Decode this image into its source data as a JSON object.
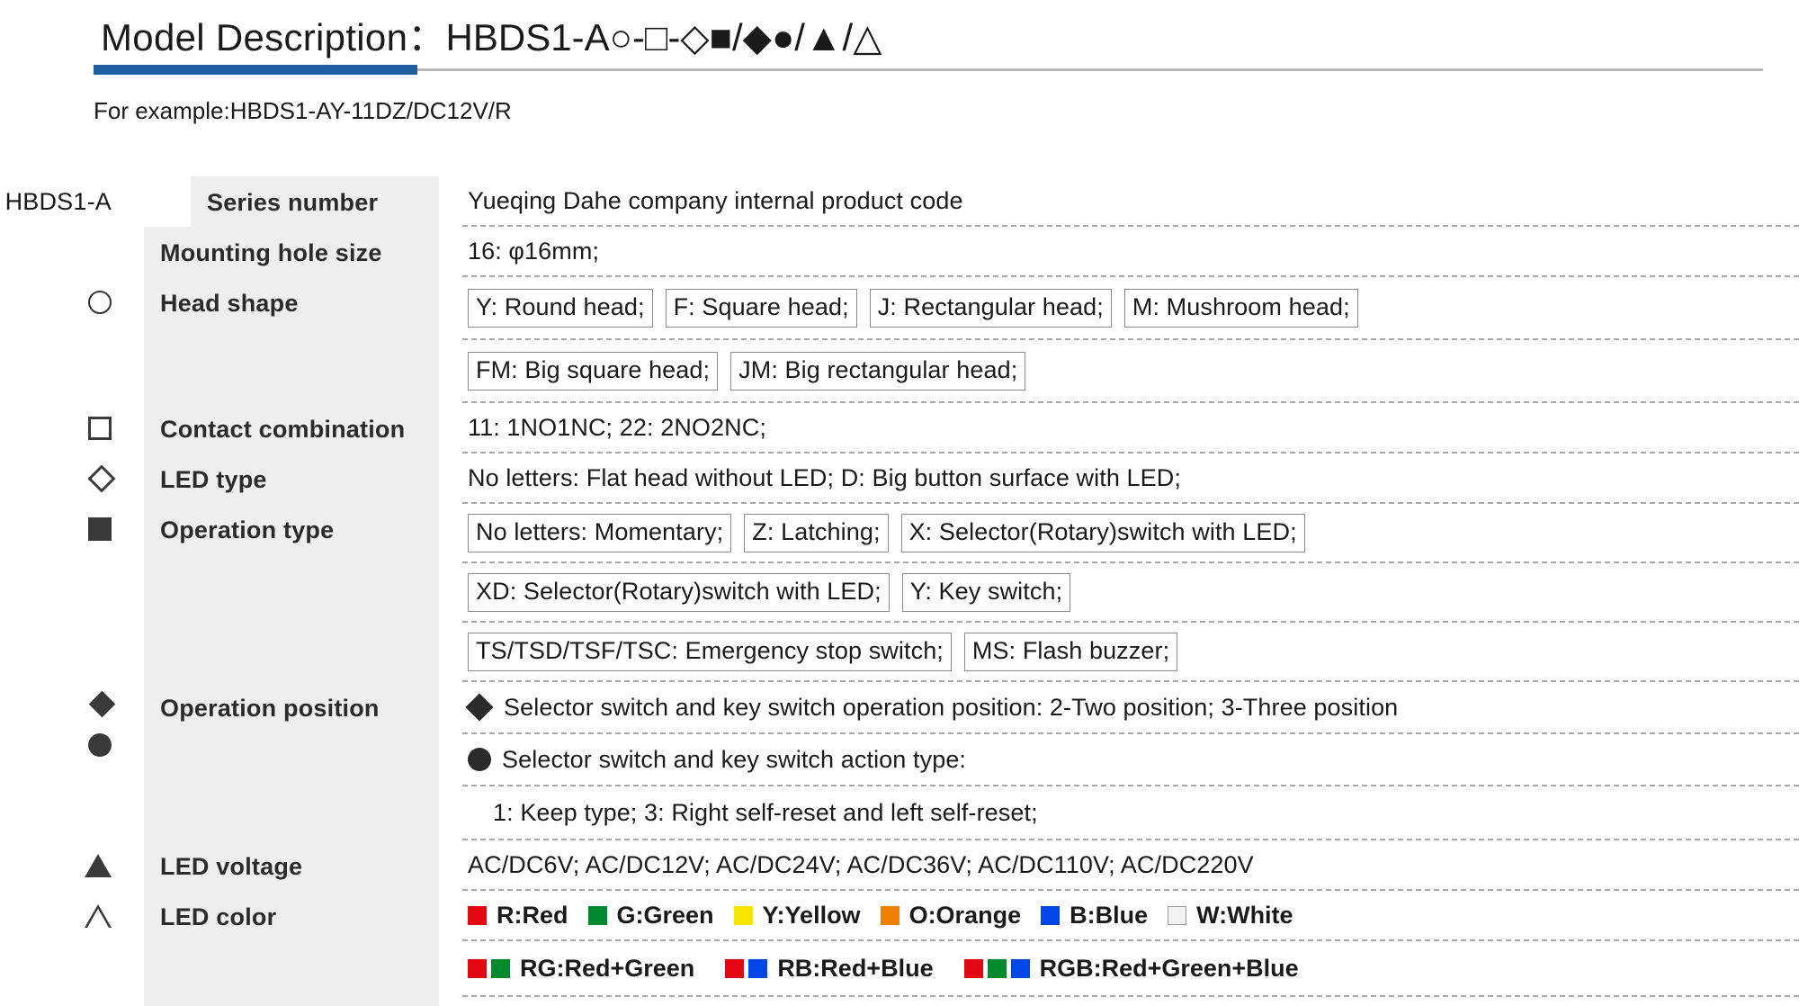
{
  "header": {
    "title_label": "Model Description：",
    "model_code": "HBDS1-A○-□-◇■/◆●/▲/△",
    "example": "For example:HBDS1-AY-11DZ/DC12V/R",
    "accent_color": "#1f5fa0"
  },
  "series_code": "HBDS1-A",
  "rows": {
    "series_number": {
      "label": "Series number",
      "value": "Yueqing Dahe company internal product code"
    },
    "mounting_hole": {
      "label": "Mounting hole size",
      "value": "16: φ16mm;"
    },
    "head_shape": {
      "label": "Head  shape",
      "symbol": "circle-hollow",
      "chips_line1": [
        "Y: Round head;",
        "F: Square head;",
        "J: Rectangular head;",
        "M: Mushroom head;"
      ],
      "chips_line2": [
        "FM: Big square head;",
        "JM: Big rectangular head;"
      ]
    },
    "contact_combination": {
      "label": "Contact combination",
      "symbol": "square-hollow",
      "value": "11: 1NO1NC;   22: 2NO2NC;"
    },
    "led_type": {
      "label": "LED type",
      "symbol": "diamond-hollow",
      "value": "No letters: Flat head without LED;   D: Big button surface with LED;"
    },
    "operation_type": {
      "label": "Operation type",
      "symbol": "square-filled",
      "chips_line1": [
        "No letters: Momentary;",
        "Z: Latching;",
        "X: Selector(Rotary)switch with LED;"
      ],
      "chips_line2": [
        "XD: Selector(Rotary)switch with LED;",
        "Y: Key switch;"
      ],
      "chips_line3": [
        "TS/TSD/TSF/TSC: Emergency stop switch;",
        "MS: Flash buzzer;"
      ]
    },
    "operation_position": {
      "label": "Operation position",
      "symbols": [
        "diamond-filled",
        "circle-filled"
      ],
      "line1": "Selector switch and key switch operation position: 2-Two position;   3-Three position",
      "line2": "Selector switch and key switch action type:",
      "line3": "1: Keep type;   3: Right self-reset and left self-reset;"
    },
    "led_voltage": {
      "label": "LED voltage",
      "symbol": "triangle-filled",
      "value": "AC/DC6V;  AC/DC12V;  AC/DC24V;  AC/DC36V;  AC/DC110V;  AC/DC220V"
    },
    "led_color": {
      "label": "LED color",
      "symbol": "triangle-hollow",
      "single_colors": [
        {
          "name": "R:Red",
          "colors": [
            "#e30613"
          ]
        },
        {
          "name": "G:Green",
          "colors": [
            "#008a2e"
          ]
        },
        {
          "name": "Y:Yellow",
          "colors": [
            "#f7e600"
          ]
        },
        {
          "name": "O:Orange",
          "colors": [
            "#f08000"
          ]
        },
        {
          "name": "B:Blue",
          "colors": [
            "#0046e6"
          ]
        },
        {
          "name": "W:White",
          "colors": [
            "#f2f2f2"
          ]
        }
      ],
      "multi_colors": [
        {
          "name": "RG:Red+Green",
          "colors": [
            "#e30613",
            "#008a2e"
          ]
        },
        {
          "name": "RB:Red+Blue",
          "colors": [
            "#e30613",
            "#0046e6"
          ]
        },
        {
          "name": "RGB:Red+Green+Blue",
          "colors": [
            "#e30613",
            "#008a2e",
            "#0046e6"
          ]
        }
      ]
    }
  }
}
